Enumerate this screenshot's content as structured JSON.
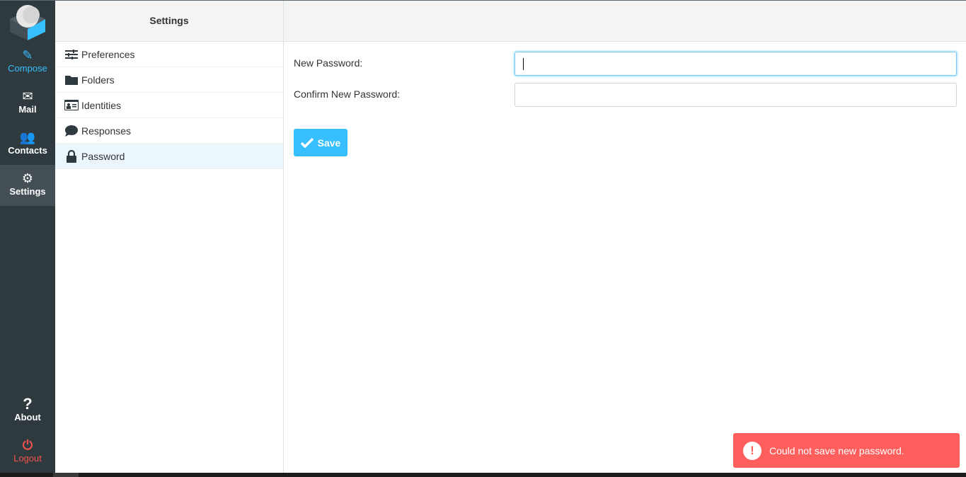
{
  "nav": {
    "items": [
      {
        "label": "Compose",
        "icon": "compose-icon"
      },
      {
        "label": "Mail",
        "icon": "envelope-icon"
      },
      {
        "label": "Contacts",
        "icon": "users-icon"
      },
      {
        "label": "Settings",
        "icon": "gear-icon"
      },
      {
        "label": "About",
        "icon": "question-icon"
      },
      {
        "label": "Logout",
        "icon": "power-icon"
      }
    ]
  },
  "settings": {
    "title": "Settings",
    "items": [
      {
        "label": "Preferences",
        "icon": "sliders-icon"
      },
      {
        "label": "Folders",
        "icon": "folder-icon"
      },
      {
        "label": "Identities",
        "icon": "id-card-icon"
      },
      {
        "label": "Responses",
        "icon": "comment-icon"
      },
      {
        "label": "Password",
        "icon": "lock-icon"
      }
    ],
    "selected": "Password"
  },
  "form": {
    "new_password_label": "New Password:",
    "new_password_value": "",
    "confirm_label": "Confirm New Password:",
    "confirm_value": "",
    "save_label": "Save"
  },
  "toast": {
    "message": "Could not save new password.",
    "icon": "!"
  },
  "colors": {
    "accent": "#37beff",
    "error": "#ff5f5c",
    "sidebar": "#2f3a3f"
  }
}
